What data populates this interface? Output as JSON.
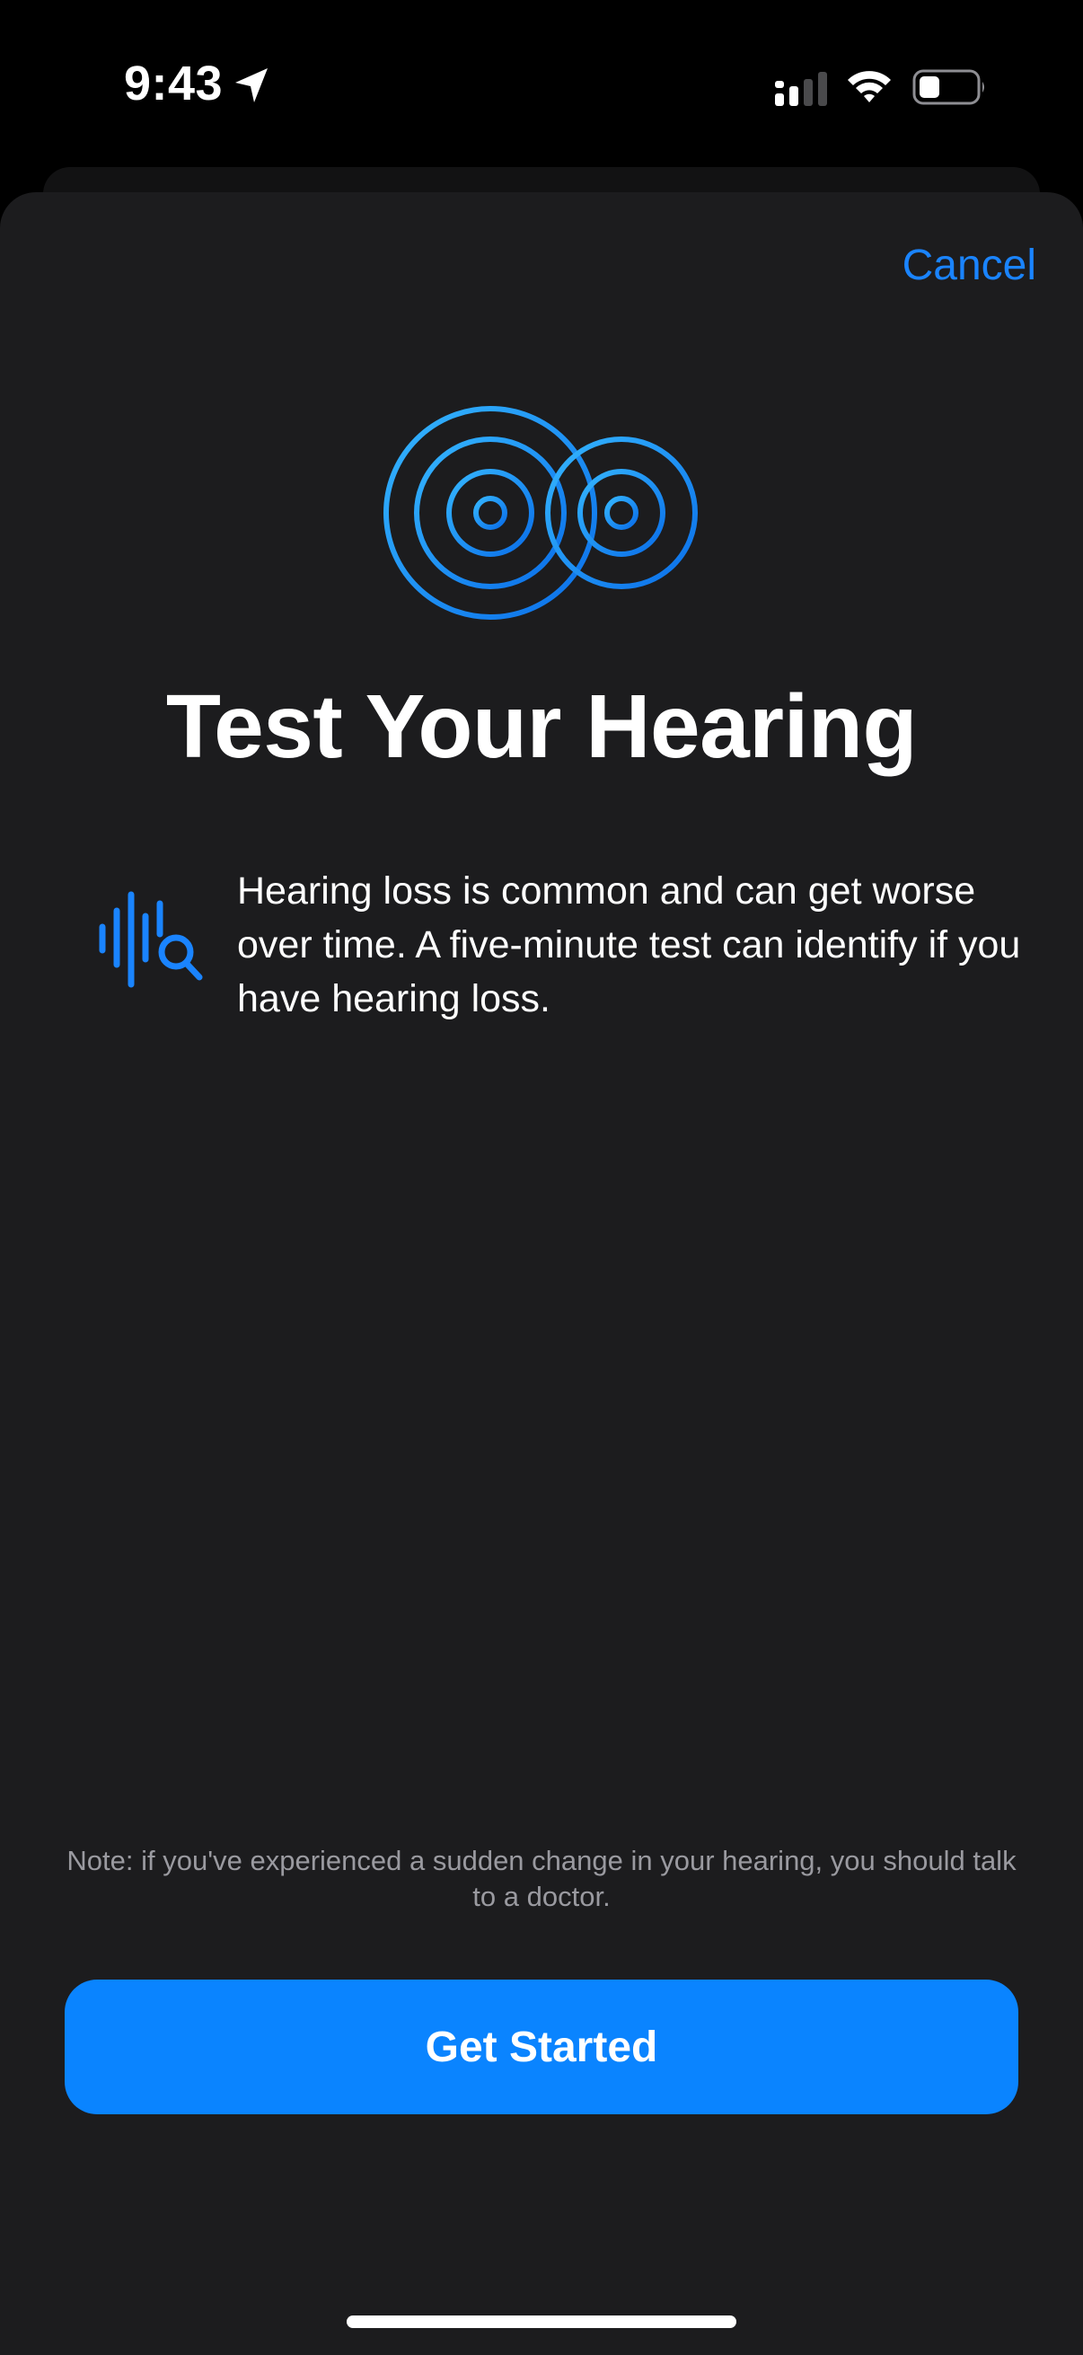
{
  "status_bar": {
    "time": "9:43",
    "icons": [
      "location-arrow-icon",
      "cellular-signal-icon",
      "wifi-icon",
      "battery-icon"
    ]
  },
  "sheet": {
    "cancel_label": "Cancel",
    "hero_icon": "hearing-rings-icon",
    "title": "Test Your Hearing",
    "feature": {
      "icon": "waveform-magnifier-icon",
      "text": "Hearing loss is common and can get worse over time. A five-minute test can identify if you have hearing loss."
    },
    "note": "Note: if you've experienced a sudden change in your hearing, you should talk to a doctor.",
    "primary_button_label": "Get Started"
  },
  "colors": {
    "accent": "#0a84ff",
    "sheet_background": "#1c1c1e",
    "background": "#000000",
    "secondary_text": "#9a9aa0"
  }
}
